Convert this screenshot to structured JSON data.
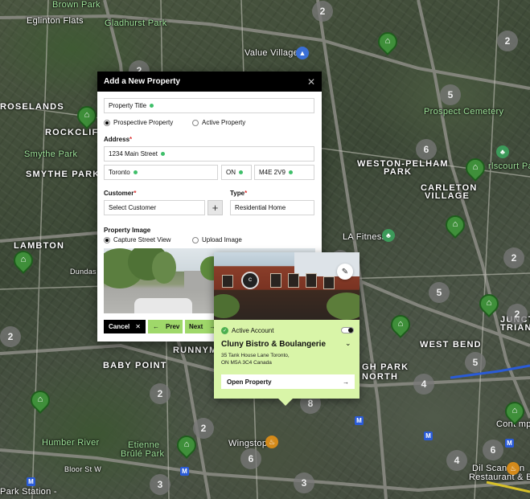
{
  "map": {
    "labels": {
      "brown_park": "Brown Park",
      "eglinton_flats": "Eglinton Flats",
      "gladhurst_park": "Gladhurst Park",
      "value_village": "Value Village",
      "roselands": "ROSELANDS",
      "rockcliffe": "ROCKCLIFFE",
      "smythe_park": "Smythe Park",
      "smythe_park_area": "SMYTHE PARK",
      "prospect_cemetery": "Prospect Cemetery",
      "weston_pellam_1": "WESTON-PELHAM",
      "weston_pellam_2": "PARK",
      "carleton_1": "CARLETON",
      "carleton_2": "VILLAGE",
      "lambton": "LAMBTON",
      "la_fitness": "LA Fitness",
      "runnymede": "RUNNYMEDE",
      "baby_point": "BABY POINT",
      "west_bend": "WEST BEND",
      "high_park_1": "GH PARK",
      "high_park_2": "NORTH",
      "junction_1": "JUNCTION",
      "junction_2": "TRIANGLE",
      "earlscourt_park": "rlscourt Park",
      "humber_river": "Humber River",
      "etienne_1": "Etienne",
      "etienne_2": "Brûlé Park",
      "wingstop": "Wingstop",
      "dufferin_1": "Dil Scandian",
      "dufferin_2": "Restaurant & Bar",
      "contemp": "Cont  mp",
      "park_station": "Park Station -",
      "dundas_st": "Dundas St",
      "bloor_st": "Bloor St W"
    },
    "clusters": [
      "2",
      "2",
      "2",
      "5",
      "6",
      "2",
      "5",
      "2",
      "5",
      "2",
      "2",
      "6",
      "8",
      "5",
      "4",
      "2",
      "6",
      "4",
      "3",
      "3",
      "8",
      "6",
      "2",
      "4"
    ]
  },
  "modal": {
    "title": "Add a New Property",
    "property_title_placeholder": "Property Title",
    "radio_prospective": "Prospective Property",
    "radio_active": "Active Property",
    "address_label": "Address",
    "street": "1234 Main Street",
    "city": "Toronto",
    "province": "ON",
    "postal": "M4E 2V9",
    "customer_label": "Customer",
    "customer_value": "Select Customer",
    "type_label": "Type",
    "type_value": "Residential Home",
    "image_label": "Property Image",
    "radio_capture": "Capture Street View",
    "radio_upload": "Upload Image",
    "cancel": "Cancel",
    "prev": "Prev",
    "next": "Next",
    "required_star": "*"
  },
  "popup": {
    "active_account": "Active Account",
    "business_name": "Cluny Bistro & Boulangerie",
    "address_line1": "35 Tank House Lane Toronto,",
    "address_line2": "ON M5A 3C4 Canada",
    "open_property": "Open Property"
  },
  "colors": {
    "pin_green": "#3f8f3a",
    "popup_bg": "#d9f5a8",
    "button_green": "#9fd86a",
    "required_dot": "#3fbf6a"
  }
}
